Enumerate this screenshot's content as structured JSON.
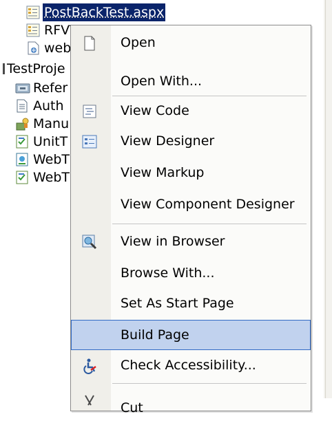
{
  "tree": {
    "items": [
      {
        "label": "PostBackTest.aspx",
        "icon": "aspx-file-icon",
        "selected": true
      },
      {
        "label": "RFVT",
        "icon": "aspx-file-icon"
      },
      {
        "label": "web.",
        "icon": "config-file-icon"
      },
      {
        "label": "TestProje",
        "icon": "project-icon"
      },
      {
        "label": "Refer",
        "icon": "references-folder-icon"
      },
      {
        "label": "Auth",
        "icon": "document-icon"
      },
      {
        "label": "Manu",
        "icon": "manual-test-icon"
      },
      {
        "label": "UnitT",
        "icon": "unit-test-icon"
      },
      {
        "label": "WebT",
        "icon": "web-test-icon"
      },
      {
        "label": "WebT",
        "icon": "unit-test-icon"
      }
    ]
  },
  "menu": {
    "items": [
      {
        "label": "Open",
        "icon": "open-file-icon"
      },
      {
        "label": "Open With..."
      },
      {
        "label": "View Code",
        "icon": "view-code-icon"
      },
      {
        "label": "View Designer",
        "icon": "view-designer-icon"
      },
      {
        "label": "View Markup"
      },
      {
        "label": "View Component Designer"
      },
      {
        "label": "View in Browser",
        "icon": "view-in-browser-icon"
      },
      {
        "label": "Browse With..."
      },
      {
        "label": "Set As Start Page"
      },
      {
        "label": "Build Page",
        "highlighted": true
      },
      {
        "label": "Check Accessibility...",
        "icon": "accessibility-icon"
      },
      {
        "label": "Cut",
        "icon": "scissors-icon"
      }
    ]
  },
  "colors": {
    "selection": "#0a246a",
    "menu_highlight": "#c1d2ee",
    "menu_highlight_border": "#316ac5",
    "gutter": "#f0efea"
  }
}
